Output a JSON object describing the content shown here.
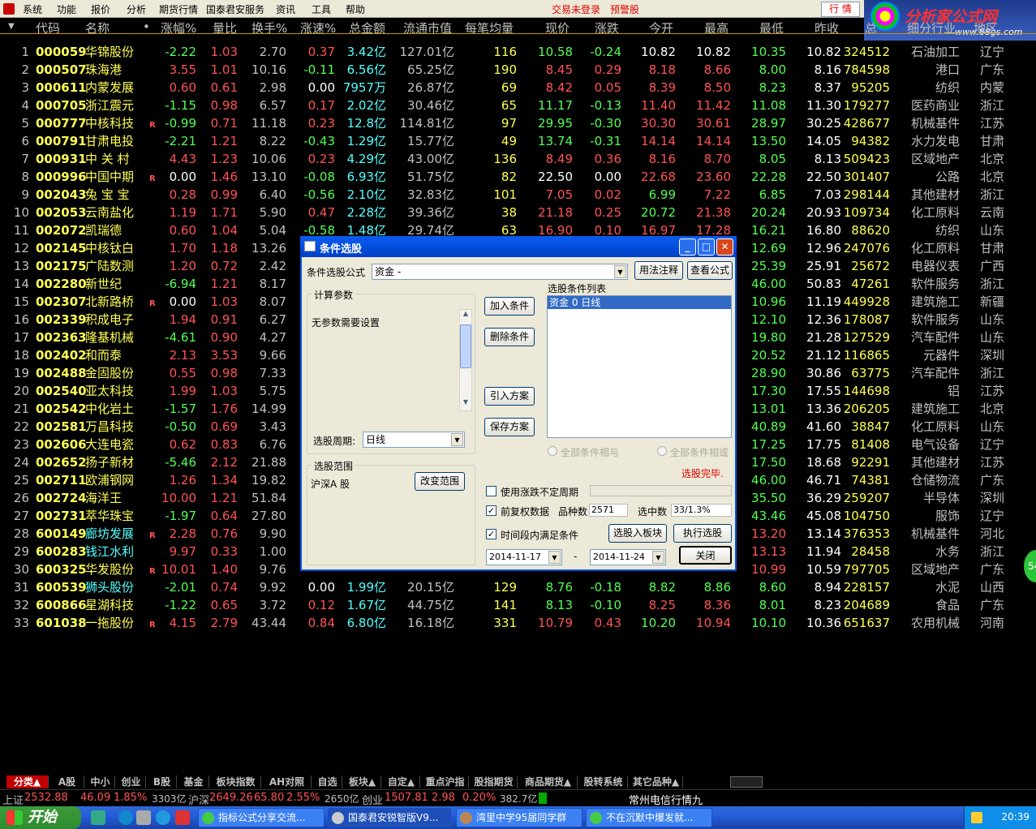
{
  "menu": {
    "items": [
      "系统",
      "功能",
      "报价",
      "分析",
      "期货行情",
      "国泰君安服务",
      "资讯",
      "工具",
      "帮助"
    ],
    "status_login": "交易未登录",
    "status_alert": "预警股",
    "hq_button": "行 情"
  },
  "logo": {
    "title": "分析家公式网",
    "url": "www.88gs.com"
  },
  "columns": {
    "no": "",
    "code": "代码",
    "name": "名称",
    "dot": "•",
    "pct": "涨幅%",
    "vr": "量比",
    "turn": "换手%",
    "speed": "涨速%",
    "amount": "总金额",
    "mcap": "流通市值",
    "avg": "每笔均量",
    "price": "现价",
    "chg": "涨跌",
    "open": "今开",
    "high": "最高",
    "low": "最低",
    "prev": "昨收",
    "vol": "总",
    "ind": "细分行业",
    "area": "地区"
  },
  "rows": [
    {
      "no": "1",
      "code": "000059",
      "name": "华锦股份",
      "r": "",
      "pct": "-2.22",
      "vr": "1.03",
      "turn": "2.70",
      "speed": "0.37",
      "amount": "3.42亿",
      "mcap": "127.01亿",
      "avg": "116",
      "price": "10.58",
      "chg": "-0.24",
      "open": "10.82",
      "high": "10.82",
      "low": "10.35",
      "prev": "10.82",
      "vol": "324512",
      "ind": "石油加工",
      "area": "辽宁"
    },
    {
      "no": "2",
      "code": "000507",
      "name": "珠海港",
      "r": "",
      "pct": "3.55",
      "vr": "1.01",
      "turn": "10.16",
      "speed": "-0.11",
      "amount": "6.56亿",
      "mcap": "65.25亿",
      "avg": "190",
      "price": "8.45",
      "chg": "0.29",
      "open": "8.18",
      "high": "8.66",
      "low": "8.00",
      "prev": "8.16",
      "vol": "784598",
      "ind": "港口",
      "area": "广东"
    },
    {
      "no": "3",
      "code": "000611",
      "name": "内蒙发展",
      "r": "",
      "pct": "0.60",
      "vr": "0.61",
      "turn": "2.98",
      "speed": "0.00",
      "amount": "7957万",
      "mcap": "26.87亿",
      "avg": "69",
      "price": "8.42",
      "chg": "0.05",
      "open": "8.39",
      "high": "8.50",
      "low": "8.23",
      "prev": "8.37",
      "vol": "95205",
      "ind": "纺织",
      "area": "内蒙"
    },
    {
      "no": "4",
      "code": "000705",
      "name": "浙江震元",
      "r": "",
      "pct": "-1.15",
      "vr": "0.98",
      "turn": "6.57",
      "speed": "0.17",
      "amount": "2.02亿",
      "mcap": "30.46亿",
      "avg": "65",
      "price": "11.17",
      "chg": "-0.13",
      "open": "11.40",
      "high": "11.42",
      "low": "11.08",
      "prev": "11.30",
      "vol": "179277",
      "ind": "医药商业",
      "area": "浙江"
    },
    {
      "no": "5",
      "code": "000777",
      "name": "中核科技",
      "r": "R",
      "pct": "-0.99",
      "vr": "0.71",
      "turn": "11.18",
      "speed": "0.23",
      "amount": "12.8亿",
      "mcap": "114.81亿",
      "avg": "97",
      "price": "29.95",
      "chg": "-0.30",
      "open": "30.30",
      "high": "30.61",
      "low": "28.97",
      "prev": "30.25",
      "vol": "428677",
      "ind": "机械基件",
      "area": "江苏"
    },
    {
      "no": "6",
      "code": "000791",
      "name": "甘肃电投",
      "r": "",
      "pct": "-2.21",
      "vr": "1.21",
      "turn": "8.22",
      "speed": "-0.43",
      "amount": "1.29亿",
      "mcap": "15.77亿",
      "avg": "49",
      "price": "13.74",
      "chg": "-0.31",
      "open": "14.14",
      "high": "14.14",
      "low": "13.50",
      "prev": "14.05",
      "vol": "94382",
      "ind": "水力发电",
      "area": "甘肃"
    },
    {
      "no": "7",
      "code": "000931",
      "name": "中 关 村",
      "r": "",
      "pct": "4.43",
      "vr": "1.23",
      "turn": "10.06",
      "speed": "0.23",
      "amount": "4.29亿",
      "mcap": "43.00亿",
      "avg": "136",
      "price": "8.49",
      "chg": "0.36",
      "open": "8.16",
      "high": "8.70",
      "low": "8.05",
      "prev": "8.13",
      "vol": "509423",
      "ind": "区域地产",
      "area": "北京"
    },
    {
      "no": "8",
      "code": "000996",
      "name": "中国中期",
      "r": "R",
      "pct": "0.00",
      "vr": "1.46",
      "turn": "13.10",
      "speed": "-0.08",
      "amount": "6.93亿",
      "mcap": "51.75亿",
      "avg": "82",
      "price": "22.50",
      "chg": "0.00",
      "open": "22.68",
      "high": "23.60",
      "low": "22.28",
      "prev": "22.50",
      "vol": "301407",
      "ind": "公路",
      "area": "北京"
    },
    {
      "no": "9",
      "code": "002043",
      "name": "兔 宝 宝",
      "r": "",
      "pct": "0.28",
      "vr": "0.99",
      "turn": "6.40",
      "speed": "-0.56",
      "amount": "2.10亿",
      "mcap": "32.83亿",
      "avg": "101",
      "price": "7.05",
      "chg": "0.02",
      "open": "6.99",
      "high": "7.22",
      "low": "6.85",
      "prev": "7.03",
      "vol": "298144",
      "ind": "其他建材",
      "area": "浙江"
    },
    {
      "no": "10",
      "code": "002053",
      "name": "云南盐化",
      "r": "",
      "pct": "1.19",
      "vr": "1.71",
      "turn": "5.90",
      "speed": "0.47",
      "amount": "2.28亿",
      "mcap": "39.36亿",
      "avg": "38",
      "price": "21.18",
      "chg": "0.25",
      "open": "20.72",
      "high": "21.38",
      "low": "20.24",
      "prev": "20.93",
      "vol": "109734",
      "ind": "化工原料",
      "area": "云南"
    },
    {
      "no": "11",
      "code": "002072",
      "name": "凯瑞德",
      "r": "",
      "pct": "0.60",
      "vr": "1.04",
      "turn": "5.04",
      "speed": "-0.58",
      "amount": "1.48亿",
      "mcap": "29.74亿",
      "avg": "63",
      "price": "16.90",
      "chg": "0.10",
      "open": "16.97",
      "high": "17.28",
      "low": "16.21",
      "prev": "16.80",
      "vol": "88620",
      "ind": "纺织",
      "area": "山东"
    },
    {
      "no": "12",
      "code": "002145",
      "name": "中核钛白",
      "r": "",
      "pct": "1.70",
      "vr": "1.18",
      "turn": "13.26",
      "speed": "",
      "amount": "",
      "mcap": "",
      "avg": "",
      "price": "",
      "chg": "",
      "open": "",
      "high": "",
      "low": "12.69",
      "prev": "12.96",
      "vol": "247076",
      "ind": "化工原料",
      "area": "甘肃"
    },
    {
      "no": "13",
      "code": "002175",
      "name": "广陆数测",
      "r": "",
      "pct": "1.20",
      "vr": "0.72",
      "turn": "2.42",
      "speed": "",
      "amount": "",
      "mcap": "",
      "avg": "",
      "price": "",
      "chg": "",
      "open": "",
      "high": "",
      "low": "25.39",
      "prev": "25.91",
      "vol": "25672",
      "ind": "电器仪表",
      "area": "广西"
    },
    {
      "no": "14",
      "code": "002280",
      "name": "新世纪",
      "r": "",
      "pct": "-6.94",
      "vr": "1.21",
      "turn": "8.17",
      "speed": "",
      "amount": "",
      "mcap": "",
      "avg": "",
      "price": "",
      "chg": "",
      "open": "",
      "high": "",
      "low": "46.00",
      "prev": "50.83",
      "vol": "47261",
      "ind": "软件服务",
      "area": "浙江"
    },
    {
      "no": "15",
      "code": "002307",
      "name": "北新路桥",
      "r": "R",
      "pct": "0.00",
      "vr": "1.03",
      "turn": "8.07",
      "speed": "",
      "amount": "",
      "mcap": "",
      "avg": "",
      "price": "",
      "chg": "",
      "open": "",
      "high": "",
      "low": "10.96",
      "prev": "11.19",
      "vol": "449928",
      "ind": "建筑施工",
      "area": "新疆"
    },
    {
      "no": "16",
      "code": "002339",
      "name": "积成电子",
      "r": "",
      "pct": "1.94",
      "vr": "0.91",
      "turn": "6.27",
      "speed": "",
      "amount": "",
      "mcap": "",
      "avg": "",
      "price": "",
      "chg": "",
      "open": "",
      "high": "",
      "low": "12.10",
      "prev": "12.36",
      "vol": "178087",
      "ind": "软件服务",
      "area": "山东"
    },
    {
      "no": "17",
      "code": "002363",
      "name": "隆基机械",
      "r": "",
      "pct": "-4.61",
      "vr": "0.90",
      "turn": "4.27",
      "speed": "",
      "amount": "",
      "mcap": "",
      "avg": "",
      "price": "",
      "chg": "",
      "open": "",
      "high": "",
      "low": "19.80",
      "prev": "21.28",
      "vol": "127529",
      "ind": "汽车配件",
      "area": "山东"
    },
    {
      "no": "18",
      "code": "002402",
      "name": "和而泰",
      "r": "",
      "pct": "2.13",
      "vr": "3.53",
      "turn": "9.66",
      "speed": "",
      "amount": "",
      "mcap": "",
      "avg": "",
      "price": "",
      "chg": "",
      "open": "",
      "high": "",
      "low": "20.52",
      "prev": "21.12",
      "vol": "116865",
      "ind": "元器件",
      "area": "深圳"
    },
    {
      "no": "19",
      "code": "002488",
      "name": "金固股份",
      "r": "",
      "pct": "0.55",
      "vr": "0.98",
      "turn": "7.33",
      "speed": "",
      "amount": "",
      "mcap": "",
      "avg": "",
      "price": "",
      "chg": "",
      "open": "",
      "high": "",
      "low": "28.90",
      "prev": "30.86",
      "vol": "63775",
      "ind": "汽车配件",
      "area": "浙江"
    },
    {
      "no": "20",
      "code": "002540",
      "name": "亚太科技",
      "r": "",
      "pct": "1.99",
      "vr": "1.03",
      "turn": "5.75",
      "speed": "",
      "amount": "",
      "mcap": "",
      "avg": "",
      "price": "",
      "chg": "",
      "open": "",
      "high": "",
      "low": "17.30",
      "prev": "17.55",
      "vol": "144698",
      "ind": "铝",
      "area": "江苏"
    },
    {
      "no": "21",
      "code": "002542",
      "name": "中化岩土",
      "r": "",
      "pct": "-1.57",
      "vr": "1.76",
      "turn": "14.99",
      "speed": "",
      "amount": "",
      "mcap": "",
      "avg": "",
      "price": "",
      "chg": "",
      "open": "",
      "high": "",
      "low": "13.01",
      "prev": "13.36",
      "vol": "206205",
      "ind": "建筑施工",
      "area": "北京"
    },
    {
      "no": "22",
      "code": "002581",
      "name": "万昌科技",
      "r": "",
      "pct": "-0.50",
      "vr": "0.69",
      "turn": "3.43",
      "speed": "",
      "amount": "",
      "mcap": "",
      "avg": "",
      "price": "",
      "chg": "",
      "open": "",
      "high": "",
      "low": "40.89",
      "prev": "41.60",
      "vol": "38847",
      "ind": "化工原料",
      "area": "山东"
    },
    {
      "no": "23",
      "code": "002606",
      "name": "大连电瓷",
      "r": "",
      "pct": "0.62",
      "vr": "0.83",
      "turn": "6.76",
      "speed": "",
      "amount": "",
      "mcap": "",
      "avg": "",
      "price": "",
      "chg": "",
      "open": "",
      "high": "",
      "low": "17.25",
      "prev": "17.75",
      "vol": "81408",
      "ind": "电气设备",
      "area": "辽宁"
    },
    {
      "no": "24",
      "code": "002652",
      "name": "扬子新材",
      "r": "",
      "pct": "-5.46",
      "vr": "2.12",
      "turn": "21.88",
      "speed": "",
      "amount": "",
      "mcap": "",
      "avg": "",
      "price": "",
      "chg": "",
      "open": "",
      "high": "",
      "low": "17.50",
      "prev": "18.68",
      "vol": "92291",
      "ind": "其他建材",
      "area": "江苏"
    },
    {
      "no": "25",
      "code": "002711",
      "name": "欧浦钢网",
      "r": "",
      "pct": "1.26",
      "vr": "1.34",
      "turn": "19.82",
      "speed": "",
      "amount": "",
      "mcap": "",
      "avg": "",
      "price": "",
      "chg": "",
      "open": "",
      "high": "",
      "low": "46.00",
      "prev": "46.71",
      "vol": "74381",
      "ind": "仓储物流",
      "area": "广东"
    },
    {
      "no": "26",
      "code": "002724",
      "name": "海洋王",
      "r": "",
      "pct": "10.00",
      "vr": "1.21",
      "turn": "51.84",
      "speed": "",
      "amount": "",
      "mcap": "",
      "avg": "",
      "price": "",
      "chg": "",
      "open": "",
      "high": "",
      "low": "35.50",
      "prev": "36.29",
      "vol": "259207",
      "ind": "半导体",
      "area": "深圳"
    },
    {
      "no": "27",
      "code": "002731",
      "name": "萃华珠宝",
      "r": "",
      "pct": "-1.97",
      "vr": "0.64",
      "turn": "27.80",
      "speed": "",
      "amount": "",
      "mcap": "",
      "avg": "",
      "price": "",
      "chg": "",
      "open": "",
      "high": "",
      "low": "43.46",
      "prev": "45.08",
      "vol": "104750",
      "ind": "服饰",
      "area": "辽宁"
    },
    {
      "no": "28",
      "code": "600149",
      "name": "廊坊发展",
      "r": "R",
      "pct": "2.28",
      "vr": "0.76",
      "turn": "9.90",
      "speed": "",
      "amount": "",
      "mcap": "",
      "avg": "",
      "price": "",
      "chg": "",
      "open": "",
      "high": "",
      "low": "13.20",
      "prev": "13.14",
      "vol": "376353",
      "ind": "机械基件",
      "area": "河北"
    },
    {
      "no": "29",
      "code": "600283",
      "name": "钱江水利",
      "r": "",
      "pct": "9.97",
      "vr": "0.33",
      "turn": "1.00",
      "speed": "",
      "amount": "",
      "mcap": "",
      "avg": "",
      "price": "",
      "chg": "",
      "open": "",
      "high": "",
      "low": "13.13",
      "prev": "11.94",
      "vol": "28458",
      "ind": "水务",
      "area": "浙江"
    },
    {
      "no": "30",
      "code": "600325",
      "name": "华发股份",
      "r": "R",
      "pct": "10.01",
      "vr": "1.40",
      "turn": "9.76",
      "speed": "",
      "amount": "",
      "mcap": "",
      "avg": "",
      "price": "",
      "chg": "",
      "open": "",
      "high": "",
      "low": "10.99",
      "prev": "10.59",
      "vol": "797705",
      "ind": "区域地产",
      "area": "广东"
    },
    {
      "no": "31",
      "code": "600539",
      "name": "狮头股份",
      "r": "",
      "pct": "-2.01",
      "vr": "0.74",
      "turn": "9.92",
      "speed": "0.00",
      "amount": "1.99亿",
      "mcap": "20.15亿",
      "avg": "129",
      "price": "8.76",
      "chg": "-0.18",
      "open": "8.82",
      "high": "8.86",
      "low": "8.60",
      "prev": "8.94",
      "vol": "228157",
      "ind": "水泥",
      "area": "山西"
    },
    {
      "no": "32",
      "code": "600866",
      "name": "星湖科技",
      "r": "",
      "pct": "-1.22",
      "vr": "0.65",
      "turn": "3.72",
      "speed": "0.12",
      "amount": "1.67亿",
      "mcap": "44.75亿",
      "avg": "141",
      "price": "8.13",
      "chg": "-0.10",
      "open": "8.25",
      "high": "8.36",
      "low": "8.01",
      "prev": "8.23",
      "vol": "204689",
      "ind": "食品",
      "area": "广东"
    },
    {
      "no": "33",
      "code": "601038",
      "name": "一拖股份",
      "r": "R",
      "pct": "4.15",
      "vr": "2.79",
      "turn": "43.44",
      "speed": "0.84",
      "amount": "6.80亿",
      "mcap": "16.18亿",
      "avg": "331",
      "price": "10.79",
      "chg": "0.43",
      "open": "10.20",
      "high": "10.94",
      "low": "10.10",
      "prev": "10.36",
      "vol": "651637",
      "ind": "农用机械",
      "area": "河南"
    }
  ],
  "dialog": {
    "title": "条件选股",
    "formula_label": "条件选股公式",
    "formula_value": "资金        -",
    "btn_usage": "用法注释",
    "btn_view": "查看公式",
    "params_label": "计算参数",
    "params_text": "无参数需要设置",
    "period_label": "选股周期:",
    "period_value": "日线",
    "range_label": "选股范围",
    "range_value": "沪深A 股",
    "btn_change_range": "改变范围",
    "btn_add": "加入条件",
    "btn_delete": "删除条件",
    "btn_import": "引入方案",
    "btn_save": "保存方案",
    "list_label": "选股条件列表",
    "list_items": [
      "资金  0  日线"
    ],
    "radio_all_and": "全部条件相与",
    "radio_all_or": "全部条件相或",
    "status_done": "选股完毕.",
    "cb_uncertain": "使用涨跌不定周期",
    "cb_restore": "前复权数据",
    "count_label": "品种数",
    "count_value": "2571",
    "selected_label": "选中数",
    "selected_value": "33/1.3%",
    "cb_period": "时间段内满足条件",
    "btn_to_block": "选股入板块",
    "btn_execute": "执行选股",
    "date_from": "2014-11-17",
    "date_sep": "-",
    "date_to": "2014-11-24",
    "btn_close": "关闭"
  },
  "tabs": [
    "分类▲",
    "A股",
    "中小",
    "创业",
    "B股",
    "基金",
    "板块指数",
    "AH对照",
    "自选",
    "板块▲",
    "自定▲",
    "重点沪指",
    "股指期货",
    "商品期货▲",
    "股转系统",
    "其它品种▲"
  ],
  "statusbar": {
    "sh_label": "上证",
    "sh_index": "2532.88",
    "sh_chg": "46.09",
    "sh_pct": "1.85%",
    "sh_amount": "3303亿",
    "hs_label": "沪深",
    "hs_index": "2649.26",
    "hs_chg": "65.80",
    "hs_pct": "2.55%",
    "hs_amount": "2650亿",
    "cy_label": "创业",
    "cy_index": "1507.81",
    "cy_chg": "2.98",
    "cy_pct": "0.20%",
    "cy_amount": "382.7亿",
    "server": "常州电信行情九"
  },
  "taskbar": {
    "start": "开始",
    "tasks": [
      "指标公式分享交流...",
      "国泰君安锐智版V9...",
      "湾里中学95届同学群",
      "不在沉默中爆发就..."
    ],
    "clock": "20:39"
  },
  "side_badge": "54"
}
